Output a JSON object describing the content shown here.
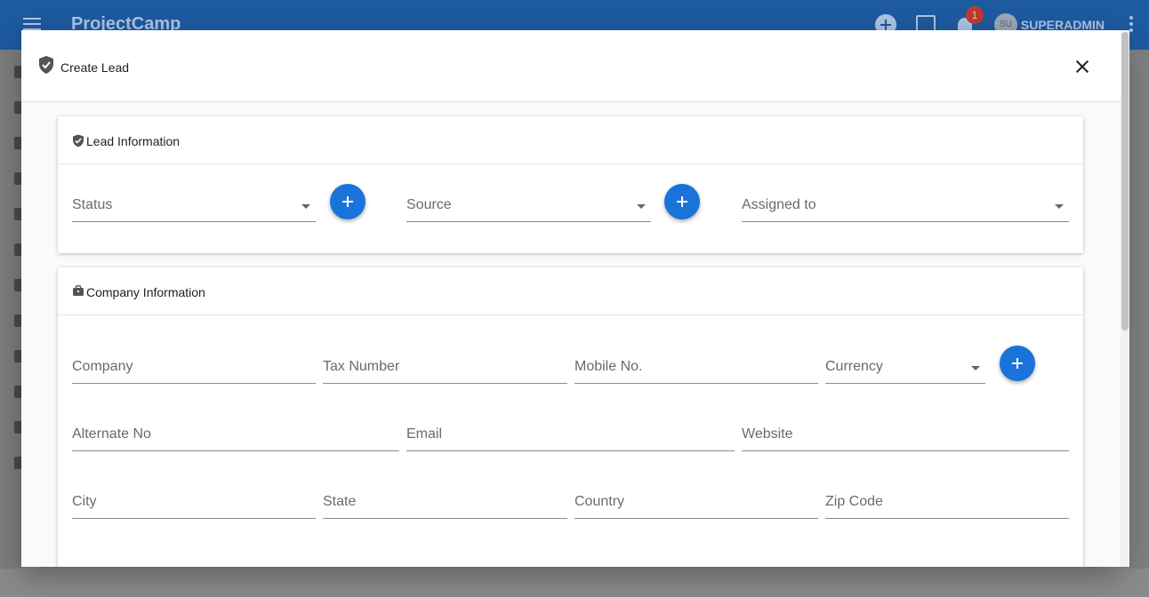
{
  "app": {
    "title": "ProjectCamp",
    "notification_count": "1",
    "user_initials": "SU",
    "user_name": "SUPERADMIN"
  },
  "icons": {
    "menu": "menu-icon",
    "add": "add-circle-icon",
    "calendar": "calendar-check-icon",
    "notifications": "bell-icon",
    "more": "more-vert-icon",
    "dialog": "shield-check-icon",
    "lead_section": "shield-check-icon",
    "company_section": "briefcase-icon",
    "close": "close-icon"
  },
  "dialog": {
    "title": "Create Lead",
    "lead_section": {
      "title": "Lead Information",
      "status_label": "Status",
      "source_label": "Source",
      "assigned_label": "Assigned to"
    },
    "company_section": {
      "title": "Company Information",
      "company_label": "Company",
      "tax_label": "Tax Number",
      "mobile_label": "Mobile No.",
      "currency_label": "Currency",
      "alternate_label": "Alternate No",
      "email_label": "Email",
      "website_label": "Website",
      "city_label": "City",
      "state_label": "State",
      "country_label": "Country",
      "zip_label": "Zip Code"
    }
  },
  "colors": {
    "primary": "#1e5aa0",
    "accent": "#1a73d9",
    "badge": "#c0392b"
  }
}
